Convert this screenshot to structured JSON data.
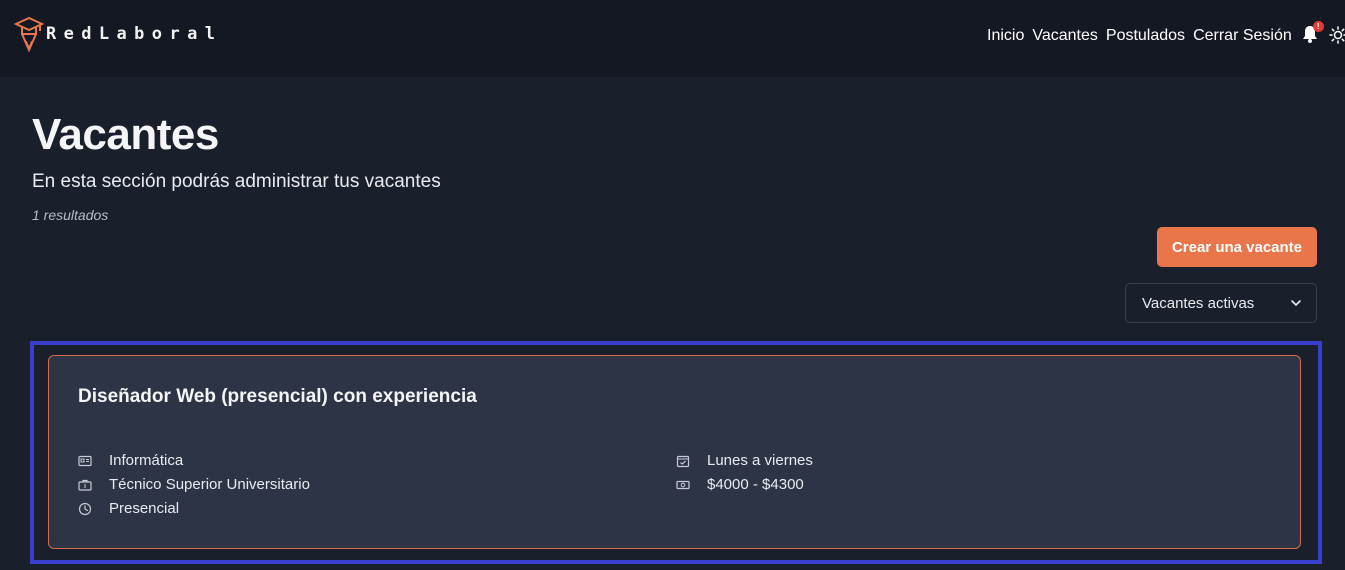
{
  "brand": {
    "name": "RedLaboral",
    "accent": "#e9764b"
  },
  "nav": {
    "links": [
      "Inicio",
      "Vacantes",
      "Postulados",
      "Cerrar Sesión"
    ],
    "notification_badge": "!",
    "icons": [
      "bell-icon",
      "sun-icon"
    ]
  },
  "page": {
    "title": "Vacantes",
    "subtitle": "En esta sección podrás administrar tus vacantes",
    "results": "1 resultados"
  },
  "actions": {
    "create_label": "Crear una vacante",
    "filter_value": "Vacantes activas"
  },
  "vacancy": {
    "title": "Diseñador Web (presencial) con experiencia",
    "category": "Informática",
    "education": "Técnico Superior Universitario",
    "modality": "Presencial",
    "schedule": "Lunes a viernes",
    "salary": "$4000 - $4300"
  }
}
